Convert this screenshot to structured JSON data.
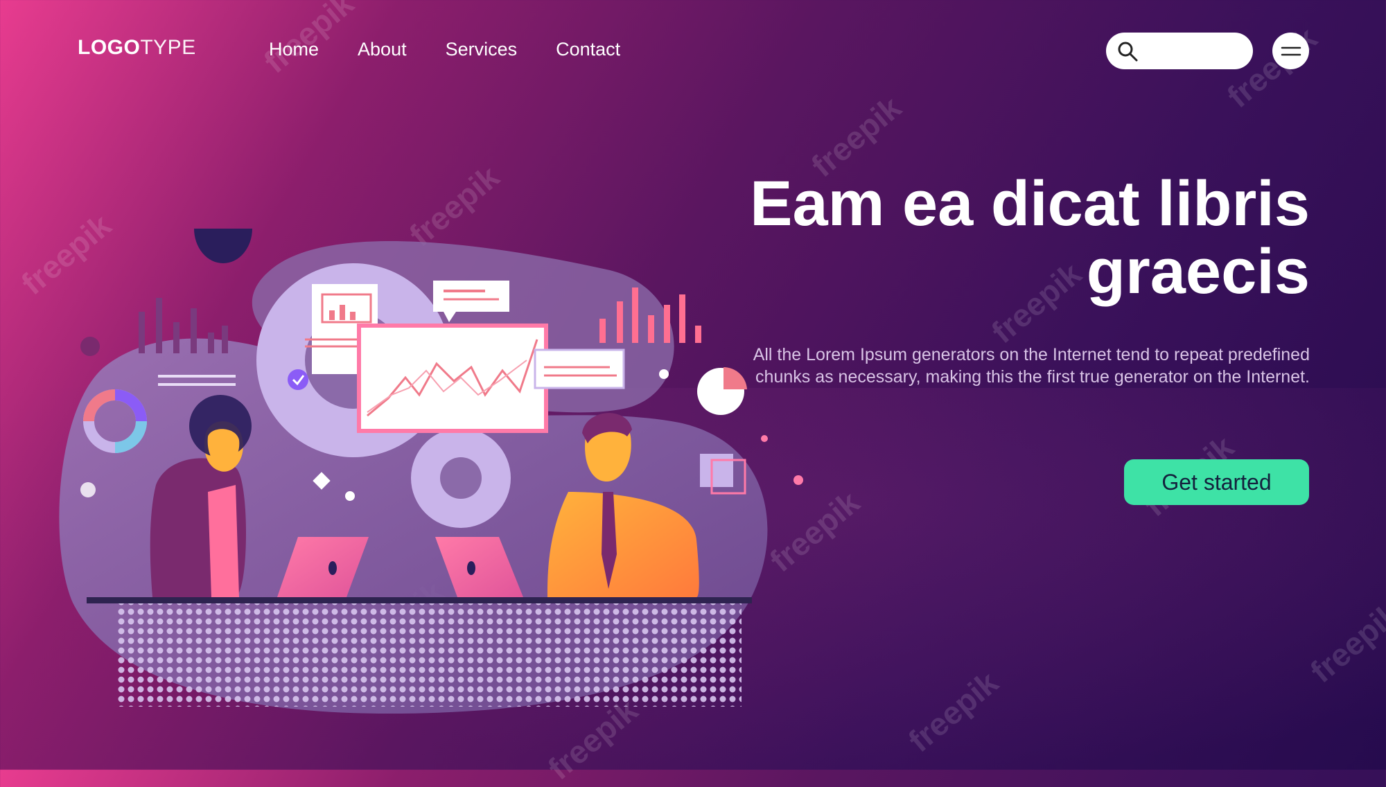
{
  "header": {
    "logo_strong": "LOGO",
    "logo_light": "TYPE",
    "nav": [
      "Home",
      "About",
      "Services",
      "Contact"
    ],
    "search": {
      "placeholder": "",
      "icon": "search-icon"
    },
    "menu_icon": "hamburger-icon"
  },
  "hero": {
    "title": "Eam ea dicat libris graecis",
    "description": "All the Lorem Ipsum generators on the Internet tend to repeat predefined chunks as necessary, making this the first true generator on the Internet.",
    "cta_label": "Get started"
  },
  "watermark": "freepik",
  "colors": {
    "accent": "#3ee2a6",
    "gradient_start": "#e83c8f",
    "gradient_end": "#260b4e",
    "illustration_blob": "#8a6aa8",
    "chart_line": "#f07a8a"
  }
}
